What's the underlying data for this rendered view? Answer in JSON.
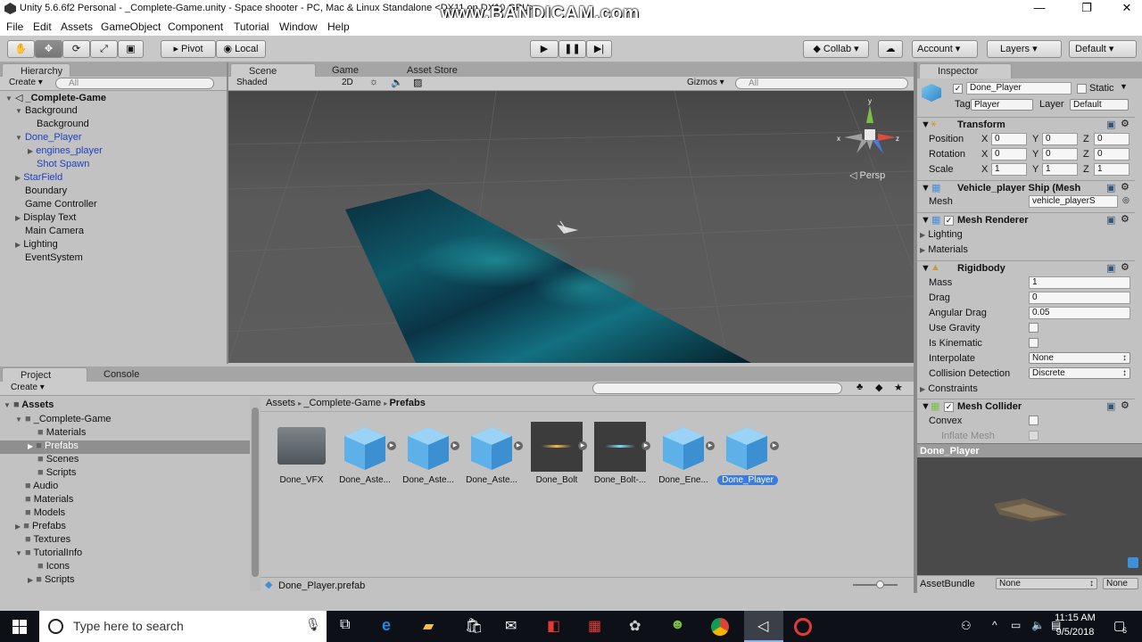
{
  "window": {
    "title": "Unity 5.6.6f2 Personal - _Complete-Game.unity - Space shooter - PC, Mac & Linux Standalone <DX11 on DX10 GPU>",
    "watermark": "www.BANDICAM.com"
  },
  "menu": [
    "File",
    "Edit",
    "Assets",
    "GameObject",
    "Component",
    "Tutorial",
    "Window",
    "Help"
  ],
  "toolbar": {
    "pivot": "Pivot",
    "local": "Local",
    "collab": "Collab ▾",
    "account": "Account",
    "layers": "Layers",
    "layout": "Default"
  },
  "hierarchy": {
    "tab": "Hierarchy",
    "create": "Create ▾",
    "search_placeholder": "All",
    "scene": "_Complete-Game",
    "items": [
      "Background",
      "Background",
      "Done_Player",
      "engines_player",
      "Shot Spawn",
      "StarField",
      "Boundary",
      "Game Controller",
      "Display Text",
      "Main Camera",
      "Lighting",
      "EventSystem"
    ]
  },
  "scene_view": {
    "tabs": [
      "Scene",
      "Game",
      "Asset Store"
    ],
    "shading": "Shaded",
    "mode2d": "2D",
    "gizmos": "Gizmos ▾",
    "search_placeholder": "All",
    "persp": "Persp"
  },
  "inspector": {
    "tab": "Inspector",
    "name": "Done_Player",
    "static": "Static",
    "tag_label": "Tag",
    "tag": "Player",
    "layer_label": "Layer",
    "layer": "Default",
    "transform": {
      "title": "Transform",
      "rows": [
        {
          "label": "Position",
          "x": "0",
          "y": "0",
          "z": "0"
        },
        {
          "label": "Rotation",
          "x": "0",
          "y": "0",
          "z": "0"
        },
        {
          "label": "Scale",
          "x": "1",
          "y": "1",
          "z": "1"
        }
      ]
    },
    "mesh_filter": {
      "title": "Vehicle_player Ship (Mesh",
      "mesh_label": "Mesh",
      "mesh": "vehicle_playerS"
    },
    "mesh_renderer": {
      "title": "Mesh Renderer",
      "lighting": "Lighting",
      "materials": "Materials"
    },
    "rigidbody": {
      "title": "Rigidbody",
      "mass_label": "Mass",
      "mass": "1",
      "drag_label": "Drag",
      "drag": "0",
      "angular_label": "Angular Drag",
      "angular": "0.05",
      "gravity_label": "Use Gravity",
      "kinematic_label": "Is Kinematic",
      "interpolate_label": "Interpolate",
      "interpolate": "None",
      "collision_label": "Collision Detection",
      "collision": "Discrete",
      "constraints": "Constraints"
    },
    "mesh_collider": {
      "title": "Mesh Collider",
      "convex": "Convex",
      "inflate": "Inflate Mesh"
    },
    "preview_title": "Done_Player",
    "assetbundle_label": "AssetBundle",
    "assetbundle": "None",
    "assetbundle2": "None"
  },
  "project": {
    "tabs": [
      "Project",
      "Console"
    ],
    "create": "Create ▾",
    "tree": [
      {
        "label": "Assets",
        "depth": 0,
        "bold": true
      },
      {
        "label": "_Complete-Game",
        "depth": 1
      },
      {
        "label": "Materials",
        "depth": 2
      },
      {
        "label": "Prefabs",
        "depth": 2
      },
      {
        "label": "Scenes",
        "depth": 2
      },
      {
        "label": "Scripts",
        "depth": 2
      },
      {
        "label": "Audio",
        "depth": 1
      },
      {
        "label": "Materials",
        "depth": 1
      },
      {
        "label": "Models",
        "depth": 1
      },
      {
        "label": "Prefabs",
        "depth": 1
      },
      {
        "label": "Textures",
        "depth": 1
      },
      {
        "label": "TutorialInfo",
        "depth": 1
      },
      {
        "label": "Icons",
        "depth": 2
      },
      {
        "label": "Scripts",
        "depth": 2
      }
    ],
    "breadcrumb": [
      "Assets",
      "_Complete-Game",
      "Prefabs"
    ],
    "assets": [
      "Done_VFX",
      "Done_Aste...",
      "Done_Aste...",
      "Done_Aste...",
      "Done_Bolt",
      "Done_Bolt-...",
      "Done_Ene...",
      "Done_Player"
    ],
    "status": "Done_Player.prefab"
  },
  "taskbar": {
    "search_placeholder": "Type here to search",
    "time": "11:15 AM",
    "date": "9/5/2018",
    "notif": "6"
  }
}
